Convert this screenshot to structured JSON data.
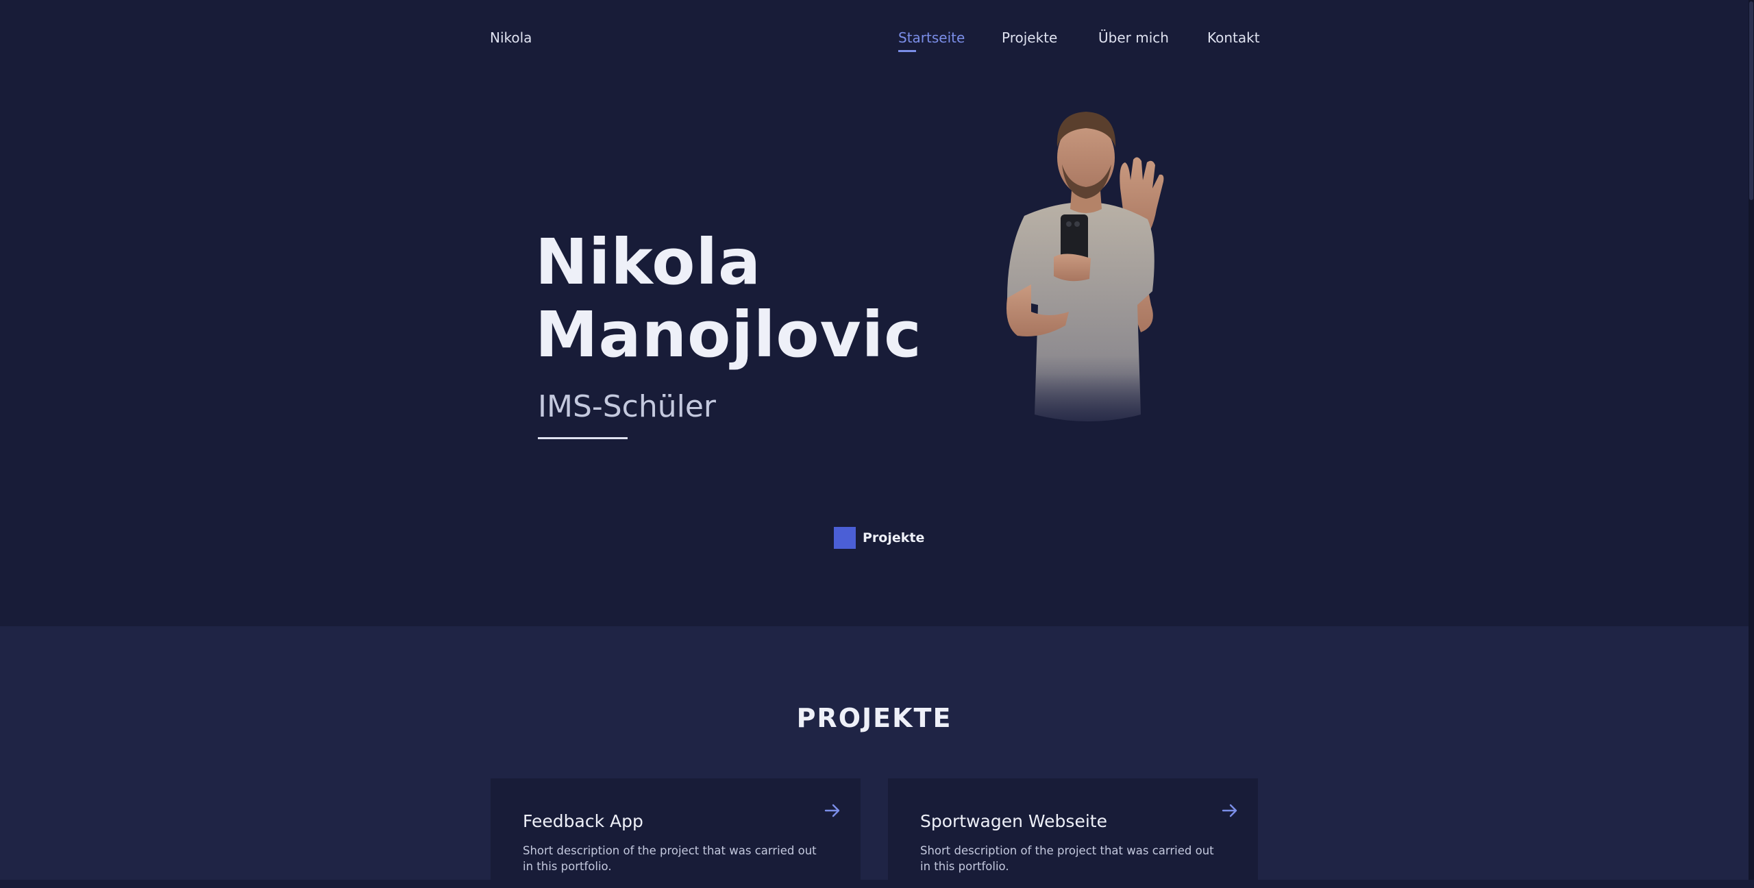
{
  "nav": {
    "brand": "Nikola",
    "links": [
      {
        "label": "Startseite",
        "active": true
      },
      {
        "label": "Projekte",
        "active": false
      },
      {
        "label": "Über mich",
        "active": false
      },
      {
        "label": "Kontakt",
        "active": false
      }
    ]
  },
  "hero": {
    "first_name": "Nikola",
    "last_name": "Manojlovic",
    "role": "IMS-Schüler",
    "cta_label": "Projekte",
    "photo_icon": "person-waving-photo"
  },
  "projects": {
    "title": "PROJEKTE",
    "cards": [
      {
        "title": "Feedback App",
        "description": "Short description of the project that was carried out in this portfolio.",
        "icon": "arrow-right-icon"
      },
      {
        "title": "Sportwagen Webseite",
        "description": "Short description of the project that was carried out in this portfolio.",
        "icon": "arrow-right-icon"
      }
    ]
  },
  "colors": {
    "background": "#181c38",
    "section_background": "#1f2445",
    "accent": "#7b8ee8",
    "cta": "#4b5fd6"
  }
}
